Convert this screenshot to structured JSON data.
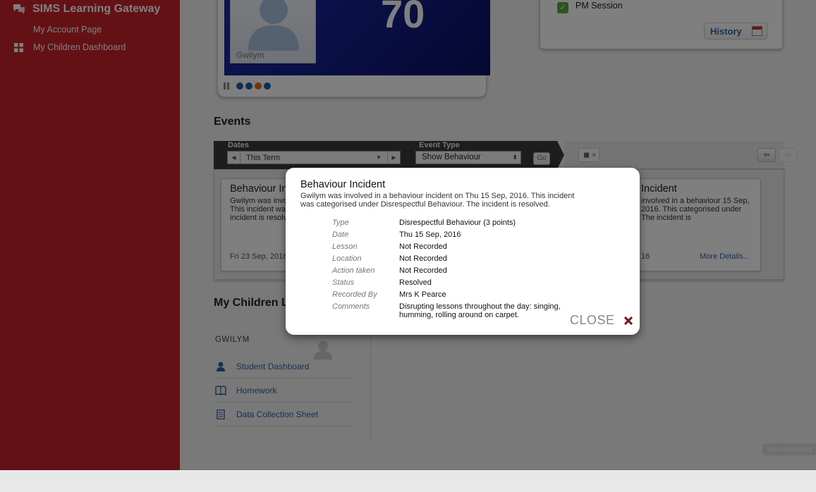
{
  "app": {
    "title": "SIMS Learning Gateway"
  },
  "sidebar": {
    "items": [
      {
        "label": "My Account Page"
      },
      {
        "label": "My Children Dashboard"
      }
    ]
  },
  "profile_card": {
    "name": "Gwilym",
    "score": "70"
  },
  "attendance": {
    "pm_session_label": "PM Session",
    "history_label": "History"
  },
  "events": {
    "heading": "Events",
    "filters": {
      "dates_label": "Dates",
      "dates_value": "This Term",
      "event_type_label": "Event Type",
      "event_type_value": "Show Behaviour",
      "go_label": "Go"
    },
    "cards": [
      {
        "title": "Behaviour Incident",
        "body_visible": "Gwilym was involved in a behaviour incident on Fri 23 Sep, 2016. This incident was categorised under Disrespectful Behaviour. The incident is resolved.",
        "date_visible": "Fri 23 Sep, 2016"
      },
      {
        "title_visible": "Incident",
        "body_visible": "involved in a behaviour 15 Sep, 2016. This categorised under The incident is",
        "date_visible": "16",
        "more": "More Details..."
      }
    ]
  },
  "children": {
    "heading": "My Children L",
    "child_name": "GWILYM",
    "links": [
      {
        "label": "Student Dashboard"
      },
      {
        "label": "Homework"
      },
      {
        "label": "Data Collection Sheet"
      }
    ]
  },
  "footer": {
    "badge": "sims supporting"
  },
  "modal": {
    "title": "Behaviour Incident",
    "summary": "Gwilym was involved in a behaviour incident on Thu 15 Sep, 2016. This incident was categorised under Disrespectful Behaviour. The incident is resolved.",
    "details": [
      {
        "label": "Type",
        "value": "Disrespectful Behaviour (3 points)"
      },
      {
        "label": "Date",
        "value": "Thu 15 Sep, 2016"
      },
      {
        "label": "Lesson",
        "value": "Not Recorded"
      },
      {
        "label": "Location",
        "value": "Not Recorded"
      },
      {
        "label": "Action taken",
        "value": "Not Recorded"
      },
      {
        "label": "Status",
        "value": "Resolved"
      },
      {
        "label": "Recorded By",
        "value": "Mrs K Pearce"
      },
      {
        "label": "Comments",
        "value": "Disrupting lessons throughout the day: singing, humming, rolling around on carpet."
      }
    ],
    "close_label": "CLOSE"
  },
  "colors": {
    "sidebar": "#c8232d",
    "link": "#2f63a6",
    "close_x": "#7a1015"
  }
}
